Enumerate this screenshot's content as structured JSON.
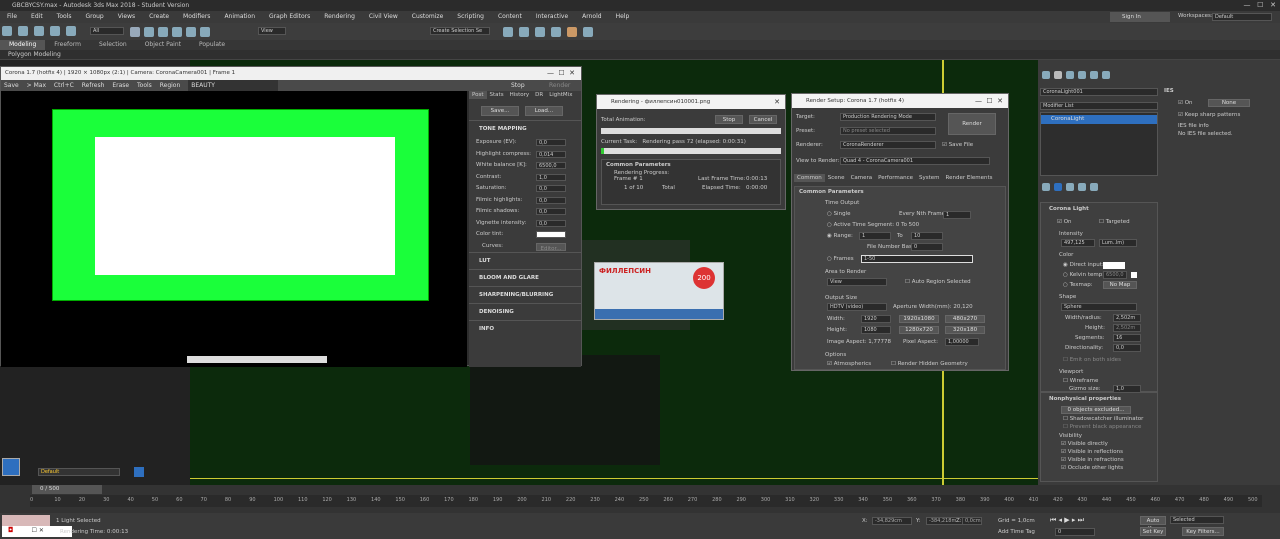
{
  "app": {
    "title": "GBCBYCSY.max - Autodesk 3ds Max 2018 - Student Version"
  },
  "menu": [
    "File",
    "Edit",
    "Tools",
    "Group",
    "Views",
    "Create",
    "Modifiers",
    "Animation",
    "Graph Editors",
    "Rendering",
    "Civil View",
    "Customize",
    "Scripting",
    "Content",
    "Interactive",
    "Arnold",
    "Help"
  ],
  "account": {
    "signin": "Sign In",
    "workspace_label": "Workspaces:",
    "workspace": "Default"
  },
  "toolbar": {
    "all_filter": "All",
    "view": "View",
    "selection_set": "Create Selection Se"
  },
  "ribbon": [
    "Modeling",
    "Freeform",
    "Selection",
    "Object Paint",
    "Populate"
  ],
  "polybar": "Polygon Modeling",
  "vfb": {
    "title": "Corona 1.7 (hotfix 4) | 1920 × 1080px (2:1) | Camera: CoronaCamera001 | Frame 1",
    "bar": [
      "Save",
      "> Max",
      "Ctrl+C",
      "Refresh",
      "Erase",
      "Tools",
      "Region"
    ],
    "channel": "BEAUTY",
    "stop": "Stop",
    "render": "Render",
    "tabs": [
      "Post",
      "Stats",
      "History",
      "DR",
      "LightMix"
    ],
    "save_btn": "Save...",
    "load_btn": "Load...",
    "tone_mapping": "TONE MAPPING",
    "params": [
      {
        "label": "Exposure (EV):",
        "value": "0,0"
      },
      {
        "label": "Highlight compress:",
        "value": "0,014"
      },
      {
        "label": "White balance [K]:",
        "value": "6500,0"
      },
      {
        "label": "Contrast:",
        "value": "1,0"
      },
      {
        "label": "Saturation:",
        "value": "0,0"
      },
      {
        "label": "Filmic highlights:",
        "value": "0,0"
      },
      {
        "label": "Filmic shadows:",
        "value": "0,0"
      },
      {
        "label": "Vignette intensity:",
        "value": "0,0"
      },
      {
        "label": "Color tint:",
        "value": ""
      }
    ],
    "curves": "Curves:",
    "editor": "Editor...",
    "sections": [
      "LUT",
      "BLOOM AND GLARE",
      "SHARPENING/BLURRING",
      "DENOISING",
      "INFO"
    ]
  },
  "rendering": {
    "title": "Rendering - филлепсин010001.png",
    "total_anim": "Total Animation:",
    "stop": "Stop",
    "cancel": "Cancel",
    "current_task_label": "Current Task:",
    "current_task": "Rendering pass 72 (elapsed: 0:00:31)",
    "common": "Common Parameters",
    "progress_label": "Rendering Progress:",
    "frame_label": "Frame #",
    "frame": "1",
    "of": "1 of 10",
    "total": "Total",
    "last_frame_label": "Last Frame Time:",
    "last_frame": "0:00:13",
    "elapsed_label": "Elapsed Time:",
    "elapsed": "0:00:00"
  },
  "render_setup": {
    "title": "Render Setup: Corona 1.7 (hotfix 4)",
    "target_label": "Target:",
    "target": "Production Rendering Mode",
    "preset_label": "Preset:",
    "preset": "No preset selected",
    "renderer_label": "Renderer:",
    "renderer": "CoronaRenderer",
    "save_file": "Save File",
    "render_btn": "Render",
    "view_label": "View to Render:",
    "view": "Quad 4 - CoronaCamera001",
    "tabs": [
      "Common",
      "Scene",
      "Camera",
      "Performance",
      "System",
      "Render Elements"
    ],
    "common_params": "Common Parameters",
    "time_output": "Time Output",
    "single": "Single",
    "every_nth": "Every Nth Frame:",
    "every_nth_val": "1",
    "active_segment": "Active Time Segment:",
    "active_segment_val": "0 To 500",
    "range": "Range:",
    "range_from": "1",
    "to": "To",
    "range_to": "10",
    "file_base": "File Number Base:",
    "file_base_val": "0",
    "frames": "Frames",
    "frames_val": "1-50",
    "area_label": "Area to Render",
    "area": "View",
    "auto_region": "Auto Region Selected",
    "output_size": "Output Size",
    "hdtv": "HDTV (video)",
    "aperture": "Aperture Width(mm): 20,120",
    "width_label": "Width:",
    "width": "1920",
    "height_label": "Height:",
    "height": "1080",
    "presets": [
      "1920x1080",
      "480x270",
      "1280x720",
      "320x180"
    ],
    "image_aspect": "Image Aspect: 1,77778",
    "pixel_aspect_label": "Pixel Aspect:",
    "pixel_aspect": "1,00000",
    "options": "Options",
    "atmospherics": "Atmospherics",
    "hidden_geo": "Render Hidden Geometry"
  },
  "package": {
    "brand": "ФИЛЛЕПСИН",
    "dose": "200"
  },
  "command": {
    "object_name": "CoronaLight001",
    "modifier_list": "Modifier List",
    "stack_item": "CoronaLight",
    "ies_header": "IES",
    "ies_on": "On",
    "ies_none": "None",
    "keep_sharp": "Keep sharp patterns",
    "ies_info1": "IES file info",
    "ies_info2": "No IES file selected.",
    "corona_light": "Corona Light",
    "on": "On",
    "targeted": "Targeted",
    "intensity_label": "Intensity",
    "intensity": "497,125",
    "unit": "Lum..lm)",
    "color_label": "Color",
    "direct_input": "Direct input:",
    "kelvin": "Kelvin temp:",
    "kelvin_val": "6500,0",
    "texmap": "Texmap:",
    "no_map": "No Map",
    "shape_label": "Shape",
    "shape": "Sphere",
    "radius_label": "Width/radius:",
    "radius": "2,502m",
    "height_label": "Height:",
    "height": "2,502m",
    "segments_label": "Segments:",
    "segments": "16",
    "directionality_label": "Directionality:",
    "directionality": "0,0",
    "emit_both": "Emit on both sides",
    "viewport": "Viewport",
    "wireframe": "Wireframe",
    "gizmo_label": "Gizmo size:",
    "gizmo": "1,0",
    "nonphys": "Nonphysical properties",
    "excluded": "0 objects excluded...",
    "shadowcatcher": "Shadowcatcher illuminator",
    "prevent_black": "Prevent black appearance",
    "visibility": "Visibility",
    "vis": [
      "Visible directly",
      "Visible in reflections",
      "Visible in refractions",
      "Occlude other lights"
    ]
  },
  "layer": {
    "name": "Default"
  },
  "timeline": {
    "frame": "0 / 500",
    "ticks": [
      "0",
      "10",
      "20",
      "30",
      "40",
      "50",
      "60",
      "70",
      "80",
      "90",
      "100",
      "110",
      "120",
      "130",
      "140",
      "150",
      "160",
      "170",
      "180",
      "190",
      "200",
      "210",
      "220",
      "230",
      "240",
      "250",
      "260",
      "270",
      "280",
      "290",
      "300",
      "310",
      "320",
      "330",
      "340",
      "350",
      "360",
      "370",
      "380",
      "390",
      "400",
      "410",
      "420",
      "430",
      "440",
      "450",
      "460",
      "470",
      "480",
      "490",
      "500"
    ]
  },
  "status": {
    "selected": "1 Light Selected",
    "render_time": "Rendering Time: 0:00:13",
    "x_label": "X:",
    "x": "-34,829cm",
    "y_label": "Y:",
    "y": "-384,218m",
    "z_label": "Z:",
    "z": "0,0cm",
    "grid": "Grid = 1,0cm",
    "add_time_tag": "Add Time Tag",
    "auto_key": "Auto Key",
    "selected_mode": "Selected",
    "set_key": "Set Key",
    "key_filters": "Key Filters...",
    "frame_field": "0"
  },
  "colors": {
    "viewport_bg": "#0c2a0c",
    "green": "#1aff3a",
    "accent_blue": "#2e6fbf"
  }
}
